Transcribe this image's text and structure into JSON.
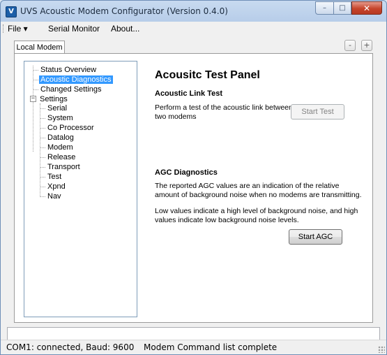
{
  "window": {
    "title": "UVS Acoustic Modem Configurator (Version 0.4.0)",
    "app_icon_glyph": "V",
    "buttons": {
      "minimize": "–",
      "maximize": "□",
      "close": "✕"
    }
  },
  "menubar": {
    "items": [
      "File ▾",
      "Serial Monitor",
      "About..."
    ]
  },
  "tabs": {
    "active": "Local Modem",
    "buttons": {
      "remove": "-",
      "add": "+"
    }
  },
  "tree": {
    "items": [
      {
        "label": "Status Overview",
        "level": 1
      },
      {
        "label": "Acoustic Diagnostics",
        "level": 1,
        "selected": true
      },
      {
        "label": "Changed Settings",
        "level": 1
      },
      {
        "label": "Settings",
        "level": 0,
        "expanded": true
      },
      {
        "label": "Serial",
        "level": 2
      },
      {
        "label": "System",
        "level": 2
      },
      {
        "label": "Co Processor",
        "level": 2
      },
      {
        "label": "Datalog",
        "level": 2
      },
      {
        "label": "Modem",
        "level": 2
      },
      {
        "label": "Release",
        "level": 2
      },
      {
        "label": "Transport",
        "level": 2
      },
      {
        "label": "Test",
        "level": 2
      },
      {
        "label": "Xpnd",
        "level": 2
      },
      {
        "label": "Nav",
        "level": 2
      }
    ],
    "expander_glyph": "−"
  },
  "panel": {
    "title": "Acousitc Test Panel",
    "link_test": {
      "heading": "Acoustic Link Test",
      "description_line1": "Perform a test of the acoustic link between",
      "description_line2": "two modems",
      "button": "Start Test",
      "button_enabled": false
    },
    "agc": {
      "heading": "AGC Diagnostics",
      "para1_line1": "The reported AGC values are an indication of the relative",
      "para1_line2": "amount of background noise when no modems are transmitting.",
      "para2_line1": "Low values indicate a high level of background noise, and high",
      "para2_line2": "values indicate low background noise levels.",
      "button": "Start AGC"
    }
  },
  "command_input": {
    "value": ""
  },
  "statusbar": {
    "connection": "COM1: connected, Baud: 9600",
    "message": "Modem Command list complete"
  }
}
